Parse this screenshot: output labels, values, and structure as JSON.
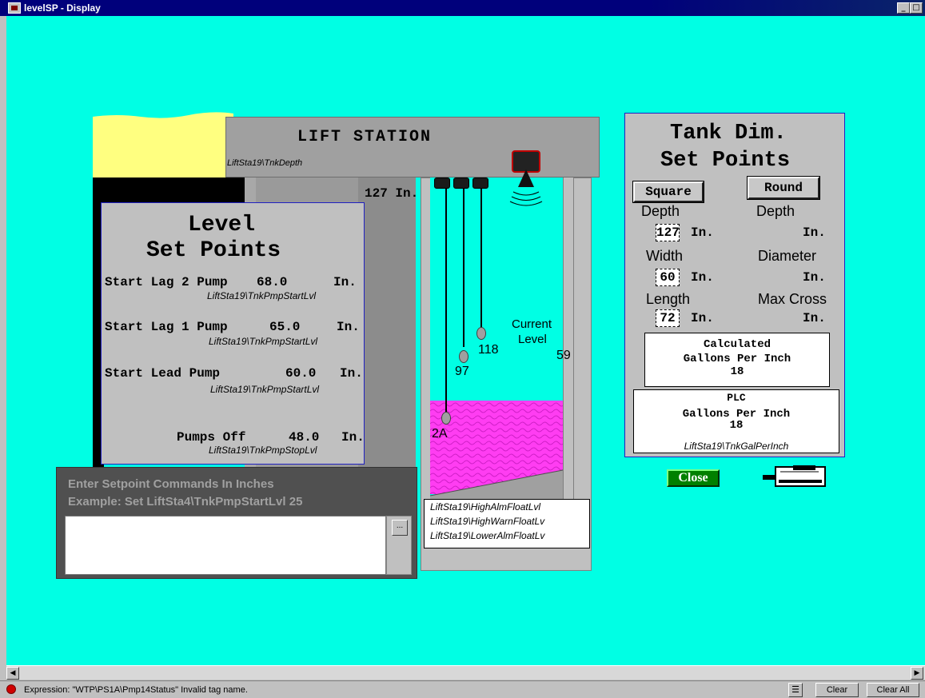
{
  "window": {
    "title": "levelSP - Display"
  },
  "lift_station": {
    "title": "LIFT STATION",
    "depth_tag": "LiftSta19\\TnkDepth",
    "depth_value": "127 In.",
    "current_level_label_1": "Current",
    "current_level_label_2": "Level",
    "current_level_value": "59",
    "float_labels": [
      "2A",
      "97",
      "118"
    ],
    "float_tags": [
      "LiftSta19\\HighAlmFloatLvl",
      "LiftSta19\\HighWarnFloatLv",
      "LiftSta19\\LowerAlmFloatLv"
    ]
  },
  "level_set_points": {
    "title_1": "Level",
    "title_2": "Set Points",
    "rows": [
      {
        "label": "Start Lag 2 Pump",
        "value": "68.0",
        "unit": "In.",
        "tag": "LiftSta19\\TnkPmpStartLvl"
      },
      {
        "label": "Start Lag 1 Pump",
        "value": "65.0",
        "unit": "In.",
        "tag": "LiftSta19\\TnkPmpStartLvl"
      },
      {
        "label": "Start Lead Pump",
        "value": "60.0",
        "unit": "In.",
        "tag": "LiftSta19\\TnkPmpStartLvl"
      },
      {
        "label": "Pumps Off",
        "value": "48.0",
        "unit": "In.",
        "tag": "LiftSta19\\TnkPmpStopLvl"
      }
    ]
  },
  "command": {
    "line1": "Enter Setpoint Commands In Inches",
    "line2": "Example: Set LiftSta4\\TnkPmpStartLvl 25",
    "input_value": "",
    "browse_label": "..."
  },
  "tank_dim": {
    "title_1": "Tank Dim.",
    "title_2": "Set Points",
    "square_label": "Square",
    "round_label": "Round",
    "square": {
      "depth_label": "Depth",
      "depth_value": "127",
      "width_label": "Width",
      "width_value": "60",
      "length_label": "Length",
      "length_value": "72"
    },
    "round": {
      "depth_label": "Depth",
      "diameter_label": "Diameter",
      "max_cross_label": "Max Cross"
    },
    "unit": "In.",
    "calc_line1": "Calculated",
    "calc_line2": "Gallons Per Inch",
    "calc_value": "18",
    "plc_line1": "PLC",
    "plc_line2": "Gallons Per Inch",
    "plc_value": "18",
    "plc_tag": "LiftSta19\\TnkGalPerInch"
  },
  "close_label": "Close",
  "status": {
    "message": "Expression: \"WTP\\PS1A\\Pmp14Status\"  Invalid tag name.",
    "clear_label": "Clear",
    "clear_all_label": "Clear All"
  },
  "colors": {
    "background": "#00ffe4",
    "liquid": "#ff3df2",
    "ground": "#ffff80",
    "panel": "#c0c0c0",
    "close_button": "#008000"
  }
}
